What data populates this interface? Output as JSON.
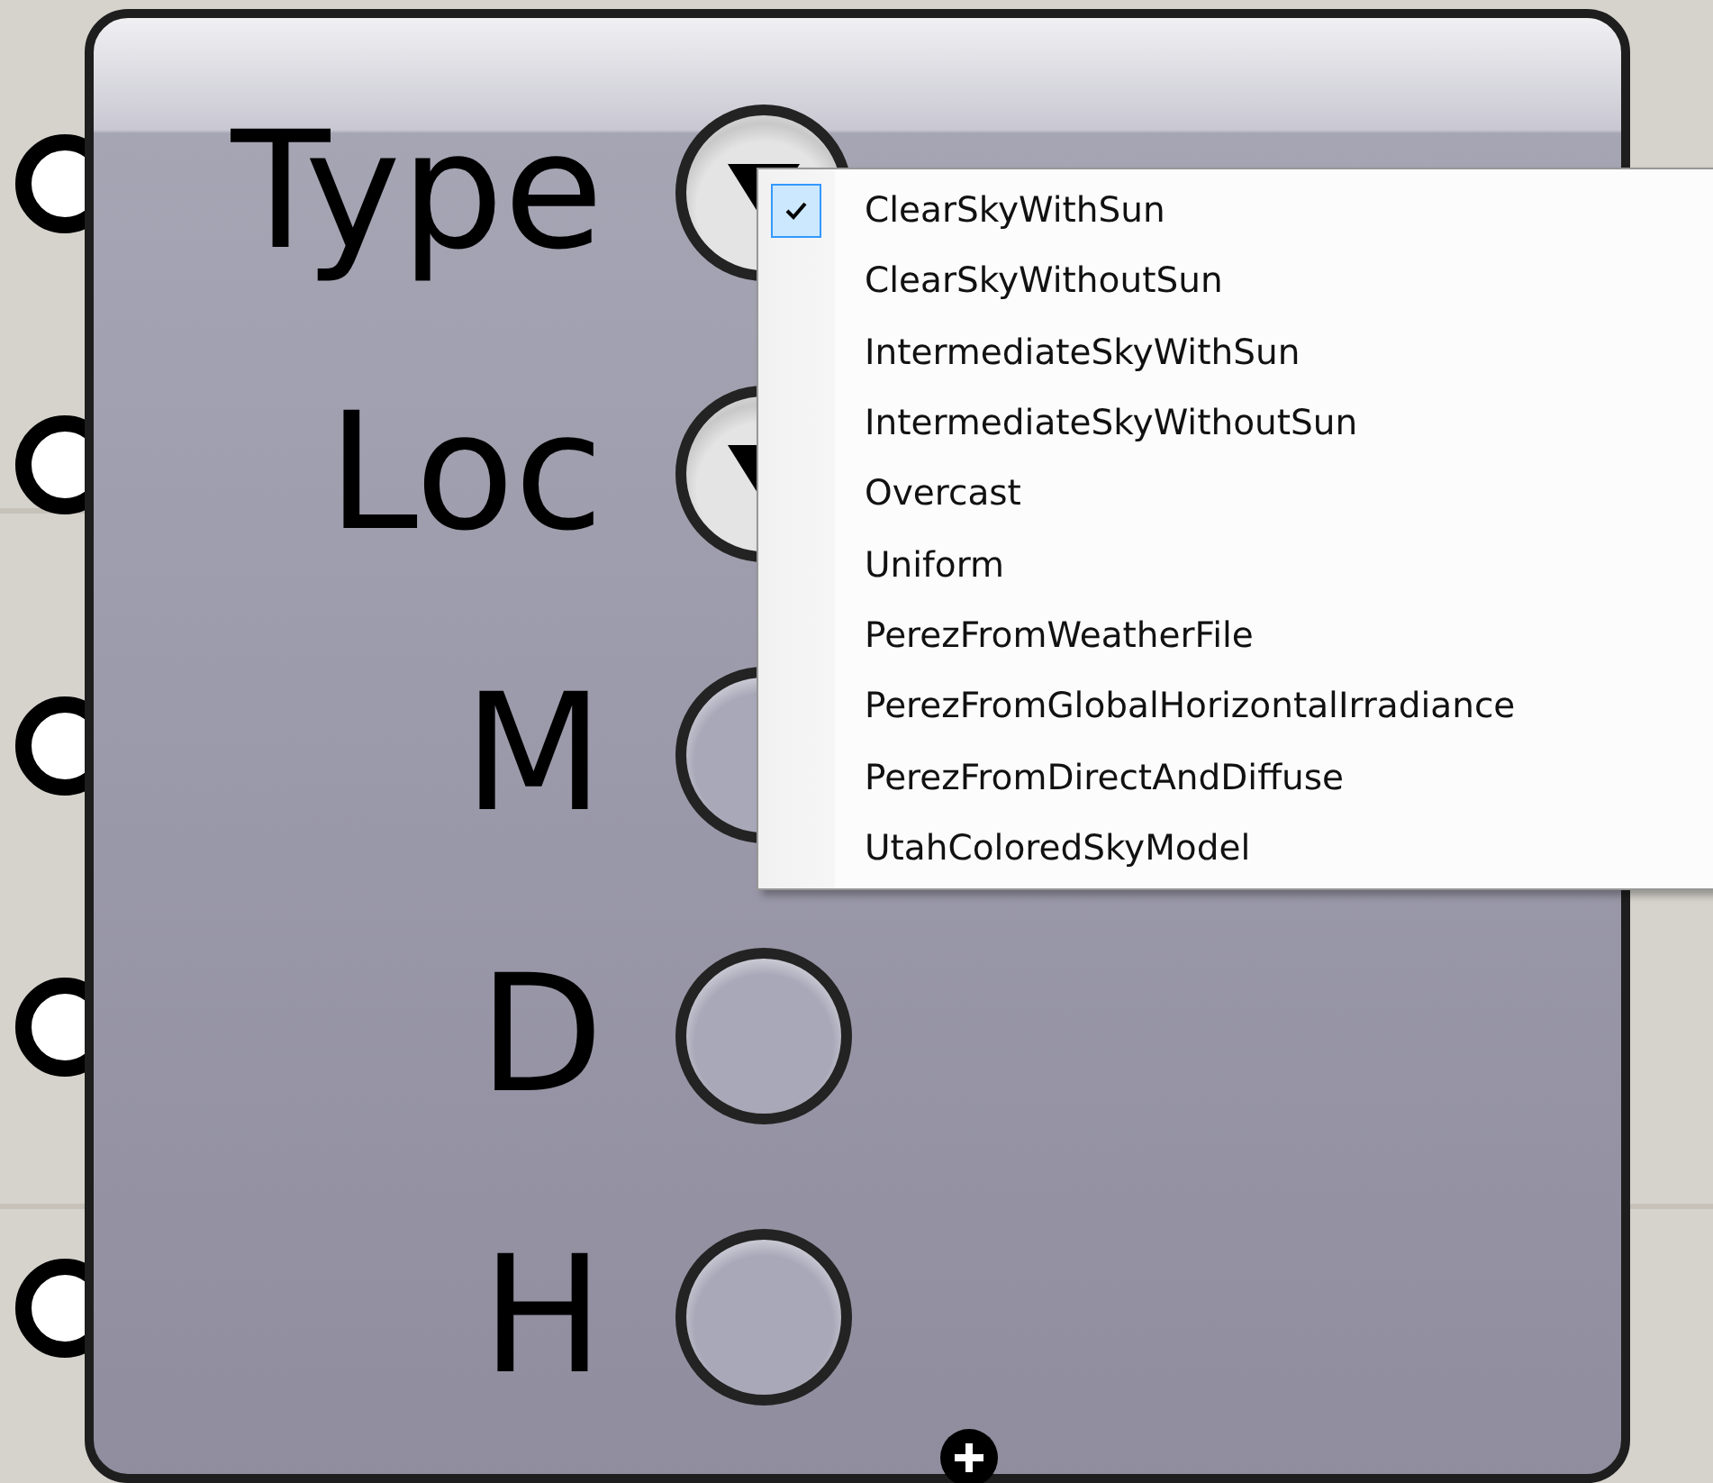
{
  "component": {
    "inputs": [
      {
        "label": "Type",
        "kind": "dropdown"
      },
      {
        "label": "Loc",
        "kind": "dropdown"
      },
      {
        "label": "M",
        "kind": "plain"
      },
      {
        "label": "D",
        "kind": "plain"
      },
      {
        "label": "H",
        "kind": "plain"
      }
    ]
  },
  "menu": {
    "items": [
      {
        "label": "ClearSkyWithSun",
        "selected": true
      },
      {
        "label": "ClearSkyWithoutSun",
        "selected": false
      },
      {
        "label": "IntermediateSkyWithSun",
        "selected": false
      },
      {
        "label": "IntermediateSkyWithoutSun",
        "selected": false
      },
      {
        "label": "Overcast",
        "selected": false
      },
      {
        "label": "Uniform",
        "selected": false
      },
      {
        "label": "PerezFromWeatherFile",
        "selected": false
      },
      {
        "label": "PerezFromGlobalHorizontalIrradiance",
        "selected": false
      },
      {
        "label": "PerezFromDirectAndDiffuse",
        "selected": false
      },
      {
        "label": "UtahColoredSkyModel",
        "selected": false
      }
    ]
  }
}
